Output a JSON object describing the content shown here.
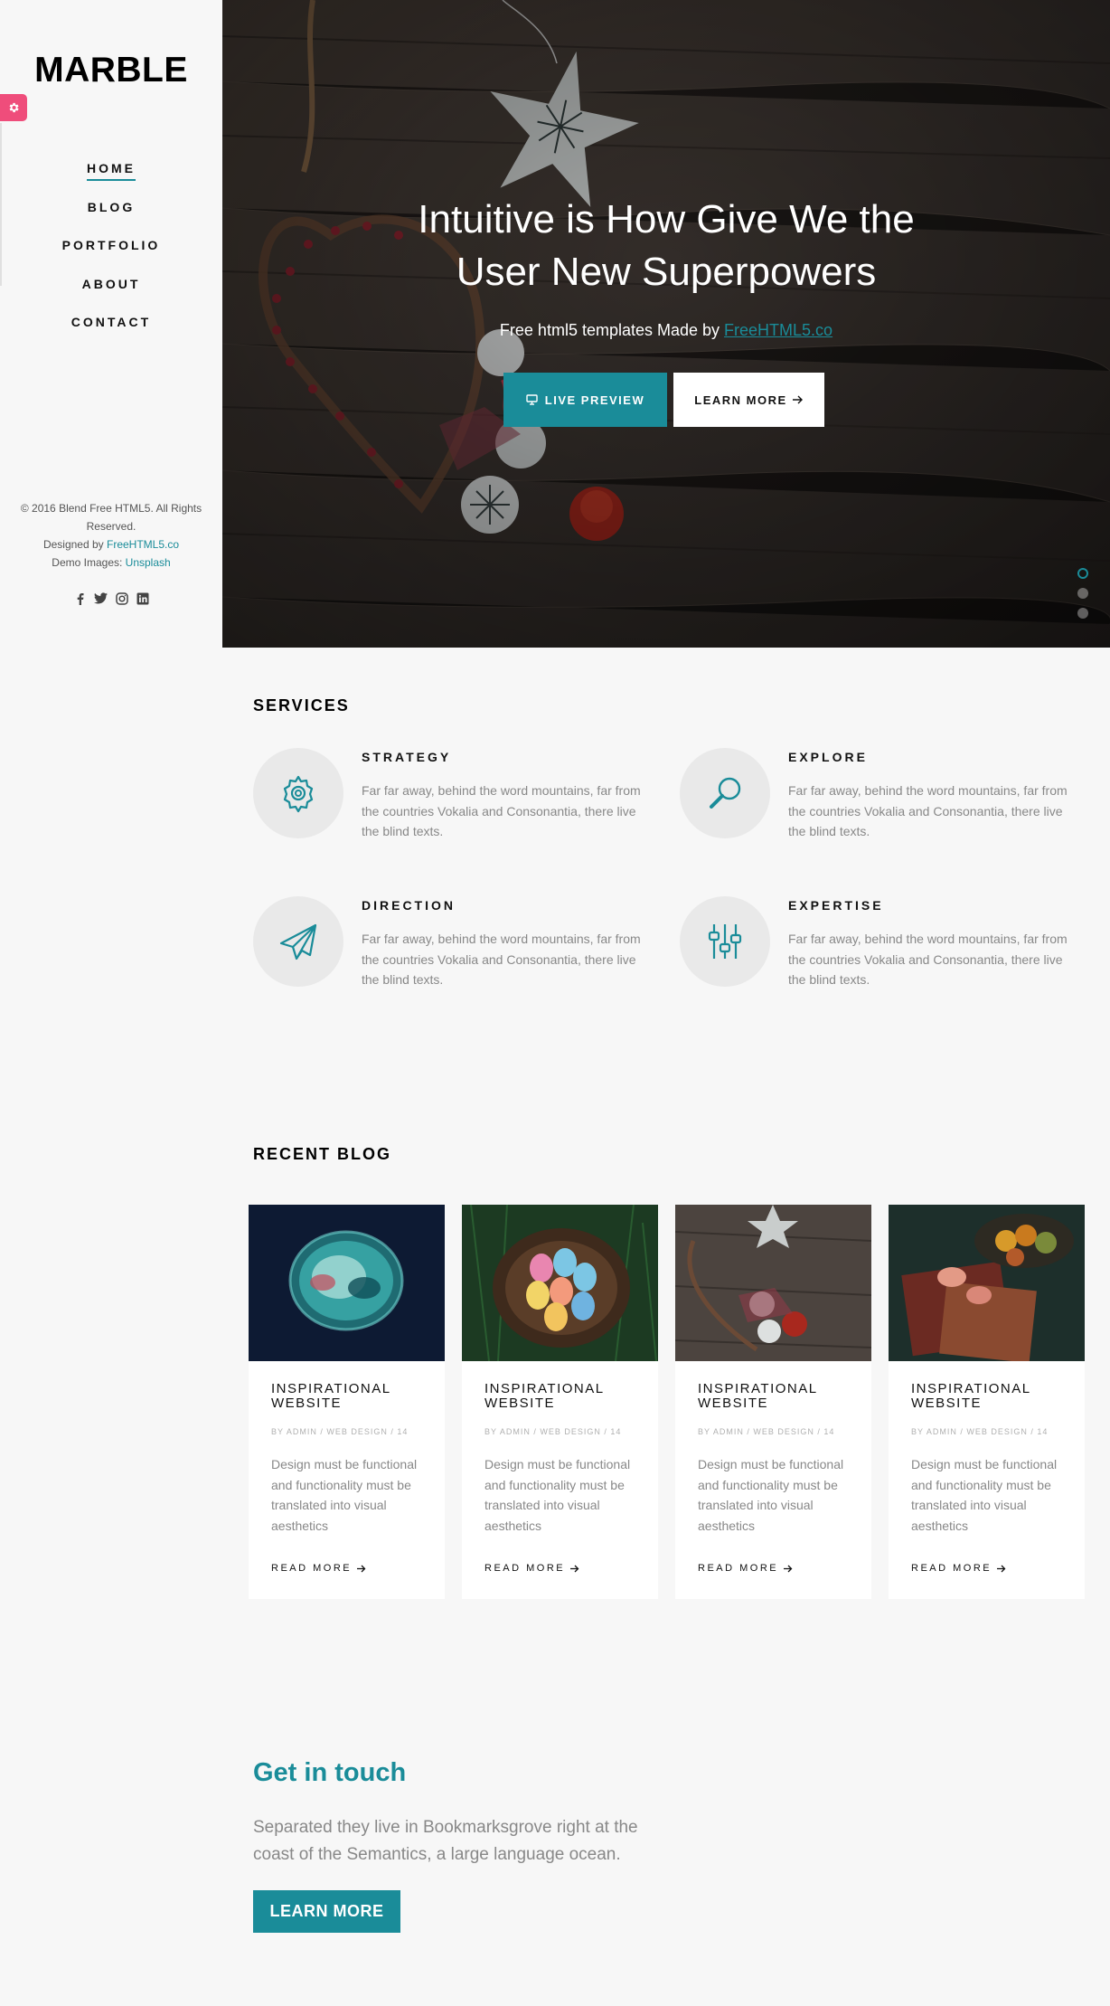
{
  "sidebar": {
    "logo": "MARBLE",
    "nav": [
      {
        "label": "HOME",
        "active": true
      },
      {
        "label": "BLOG"
      },
      {
        "label": "PORTFOLIO"
      },
      {
        "label": "ABOUT"
      },
      {
        "label": "CONTACT"
      }
    ],
    "copyright_1": "© 2016 Blend Free HTML5. All Rights Reserved.",
    "designed_by": "Designed by ",
    "designer_link": "FreeHTML5.co",
    "demo_images": "Demo Images: ",
    "images_link": "Unsplash",
    "social_icons": [
      "facebook-icon",
      "twitter-icon",
      "instagram-icon",
      "linkedin-icon"
    ]
  },
  "hero": {
    "title_line1": "Intuitive is How Give We the",
    "title_line2": "User New Superpowers",
    "subtitle": "Free html5 templates Made by ",
    "subtitle_link": "FreeHTML5.co",
    "live_preview": "LIVE PREVIEW",
    "learn_more": "LEARN MORE",
    "slides": 3,
    "active_slide": 1
  },
  "services": {
    "title": "SERVICES",
    "items": [
      {
        "name": "STRATEGY",
        "icon": "gear-icon",
        "desc": "Far far away, behind the word mountains, far from the countries Vokalia and Consonantia, there live the blind texts."
      },
      {
        "name": "EXPLORE",
        "icon": "search-icon",
        "desc": "Far far away, behind the word mountains, far from the countries Vokalia and Consonantia, there live the blind texts."
      },
      {
        "name": "DIRECTION",
        "icon": "paper-plane-icon",
        "desc": "Far far away, behind the word mountains, far from the countries Vokalia and Consonantia, there live the blind texts."
      },
      {
        "name": "EXPERTISE",
        "icon": "sliders-icon",
        "desc": "Far far away, behind the word mountains, far from the countries Vokalia and Consonantia, there live the blind texts."
      }
    ]
  },
  "blog": {
    "title": "RECENT BLOG",
    "posts": [
      {
        "title": "INSPIRATIONAL WEBSITE",
        "meta": "BY ADMIN / WEB DESIGN / 14",
        "text": "Design must be functional and functionality must be translated into visual aesthetics",
        "more": "READ MORE"
      },
      {
        "title": "INSPIRATIONAL WEBSITE",
        "meta": "BY ADMIN / WEB DESIGN / 14",
        "text": "Design must be functional and functionality must be translated into visual aesthetics",
        "more": "READ MORE"
      },
      {
        "title": "INSPIRATIONAL WEBSITE",
        "meta": "BY ADMIN / WEB DESIGN / 14",
        "text": "Design must be functional and functionality must be translated into visual aesthetics",
        "more": "READ MORE"
      },
      {
        "title": "INSPIRATIONAL WEBSITE",
        "meta": "BY ADMIN / WEB DESIGN / 14",
        "text": "Design must be functional and functionality must be translated into visual aesthetics",
        "more": "READ MORE"
      }
    ]
  },
  "contact": {
    "title": "Get in touch",
    "text": "Separated they live in Bookmarksgrove right at the coast of the Semantics, a large language ocean.",
    "button": "LEARN MORE"
  },
  "colors": {
    "accent": "#1a8c99",
    "pink": "#ef4d7b",
    "background": "#f7f7f7"
  }
}
